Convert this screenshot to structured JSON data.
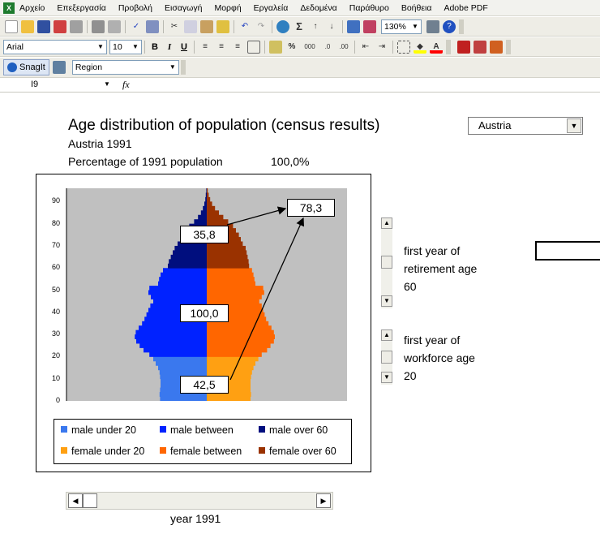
{
  "menu": [
    "Αρχείο",
    "Επεξεργασία",
    "Προβολή",
    "Εισαγωγή",
    "Μορφή",
    "Εργαλεία",
    "Δεδομένα",
    "Παράθυρο",
    "Βοήθεια",
    "Adobe PDF"
  ],
  "toolbar": {
    "zoom": "130%",
    "font": "Arial",
    "size": "10",
    "bold": "B",
    "italic": "I",
    "underline": "U",
    "percent": "%",
    "thousands": "000",
    "sigma": "Σ"
  },
  "snagit": {
    "label": "SnagIt",
    "region": "Region"
  },
  "formula_bar": {
    "cell": "I9",
    "fx": "fx"
  },
  "chart": {
    "title": "Age distribution of population (census results)",
    "subtitle": "Austria 1991",
    "percentage_label": "Percentage of 1991 population",
    "percentage_value": "100,0%",
    "country_selector": "Austria",
    "labels": {
      "over60": "35,8",
      "ratio": "78,3",
      "between": "100,0",
      "under20": "42,5"
    }
  },
  "chart_data": {
    "type": "bar",
    "orientation": "horizontal-pyramid",
    "yticks": [
      0,
      10,
      20,
      30,
      40,
      50,
      60,
      70,
      80,
      90
    ],
    "ylim": [
      0,
      96
    ],
    "ages": [
      0,
      2,
      4,
      6,
      8,
      10,
      12,
      14,
      16,
      18,
      20,
      22,
      24,
      26,
      28,
      30,
      32,
      34,
      36,
      38,
      40,
      42,
      44,
      46,
      48,
      50,
      52,
      54,
      56,
      58,
      60,
      62,
      64,
      66,
      68,
      70,
      72,
      74,
      76,
      78,
      80,
      82,
      84,
      86,
      88,
      90,
      92,
      94
    ],
    "male": [
      96,
      97,
      96,
      95,
      95,
      96,
      97,
      100,
      105,
      110,
      118,
      130,
      138,
      145,
      148,
      146,
      140,
      133,
      128,
      124,
      120,
      116,
      110,
      115,
      120,
      118,
      100,
      98,
      95,
      90,
      80,
      78,
      74,
      70,
      66,
      60,
      48,
      44,
      40,
      36,
      26,
      18,
      12,
      8,
      5,
      3,
      2,
      1
    ],
    "female": [
      90,
      91,
      90,
      90,
      90,
      91,
      93,
      96,
      100,
      106,
      113,
      124,
      131,
      138,
      140,
      138,
      133,
      127,
      122,
      119,
      116,
      113,
      108,
      113,
      118,
      116,
      100,
      98,
      96,
      93,
      87,
      86,
      84,
      82,
      80,
      74,
      70,
      66,
      60,
      54,
      44,
      34,
      25,
      17,
      11,
      7,
      4,
      2
    ],
    "series": [
      {
        "name": "male under 20",
        "color": "#3a78ee"
      },
      {
        "name": "male between",
        "color": "#0022ff"
      },
      {
        "name": "male over 60",
        "color": "#000e7e"
      },
      {
        "name": "female under 20",
        "color": "#ffa012"
      },
      {
        "name": "female between",
        "color": "#ff6600"
      },
      {
        "name": "female over 60",
        "color": "#9a3200"
      }
    ],
    "thresholds": {
      "workforce": 20,
      "retirement": 60
    }
  },
  "controls": {
    "retirement_l1": "first year of",
    "retirement_l2": "retirement age",
    "retirement_value": "60",
    "workforce_l1": "first year of",
    "workforce_l2": "workforce age",
    "workforce_value": "20",
    "year_label": "year  1991"
  }
}
